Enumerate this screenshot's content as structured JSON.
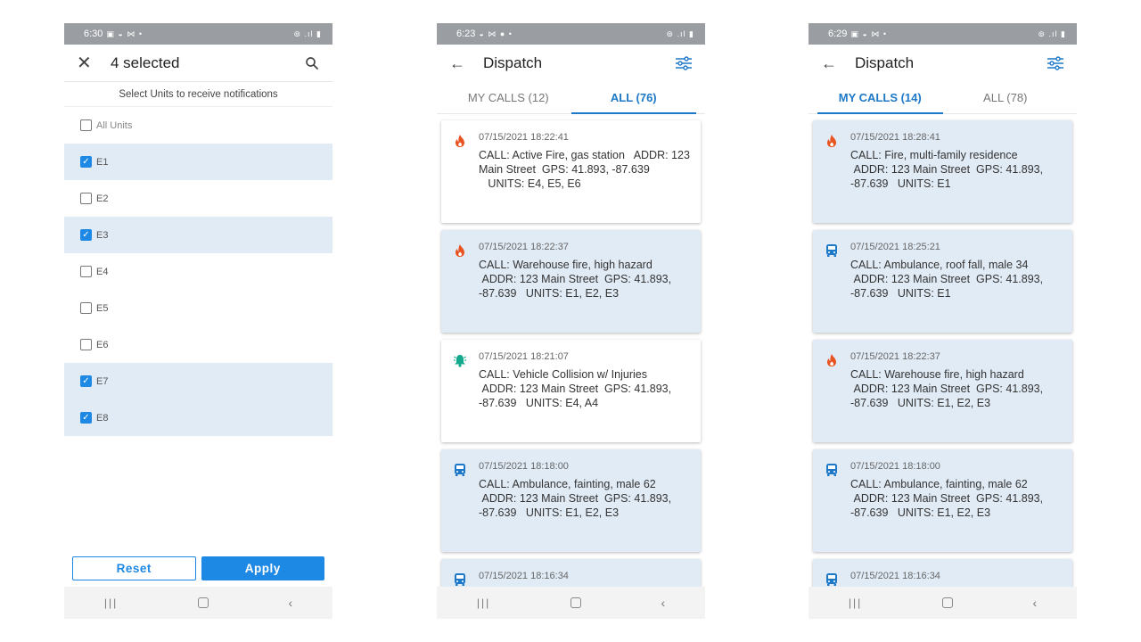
{
  "phone1": {
    "status_time": "6:30",
    "status_icons_left": "▣ ◒ ⋈ •",
    "status_icons_right": "⊚ .ıl ▮",
    "title": "4 selected",
    "subtitle": "Select Units to receive notifications",
    "all_units_label": "All Units",
    "units": [
      {
        "label": "E1",
        "checked": true
      },
      {
        "label": "E2",
        "checked": false
      },
      {
        "label": "E3",
        "checked": true
      },
      {
        "label": "E4",
        "checked": false
      },
      {
        "label": "E5",
        "checked": false
      },
      {
        "label": "E6",
        "checked": false
      },
      {
        "label": "E7",
        "checked": true
      },
      {
        "label": "E8",
        "checked": true
      }
    ],
    "reset_label": "Reset",
    "apply_label": "Apply"
  },
  "phone2": {
    "status_time": "6:23",
    "status_icons_left": "◒ ⋈ ● •",
    "status_icons_right": "⊚ .ıl ▮",
    "title": "Dispatch",
    "tab_my_calls": "MY CALLS (12)",
    "tab_all": "ALL (76)",
    "active_tab": "all",
    "cards": [
      {
        "icon": "fire-icon",
        "highlight": false,
        "time": "07/15/2021 18:22:41",
        "text": "CALL: Active Fire, gas station   ADDR: 123 Main Street  GPS: 41.893, -87.639\n   UNITS: E4, E5, E6"
      },
      {
        "icon": "fire-icon",
        "highlight": true,
        "time": "07/15/2021 18:22:37",
        "text": "CALL: Warehouse fire, high hazard\n ADDR: 123 Main Street  GPS: 41.893, -87.639   UNITS: E1, E2, E3"
      },
      {
        "icon": "alarm-bell-icon",
        "highlight": false,
        "time": "07/15/2021 18:21:07",
        "text": "CALL: Vehicle Collision w/ Injuries\n ADDR: 123 Main Street  GPS: 41.893, -87.639   UNITS: E4, A4"
      },
      {
        "icon": "ambulance-icon",
        "highlight": true,
        "time": "07/15/2021 18:18:00",
        "text": "CALL: Ambulance, fainting, male 62\n ADDR: 123 Main Street  GPS: 41.893, -87.639   UNITS: E1, E2, E3"
      },
      {
        "icon": "ambulance-icon",
        "highlight": true,
        "time": "07/15/2021 18:16:34",
        "text": ""
      }
    ]
  },
  "phone3": {
    "status_time": "6:29",
    "status_icons_left": "▣ ◒ ⋈ •",
    "status_icons_right": "⊚ .ıl ▮",
    "title": "Dispatch",
    "tab_my_calls": "MY CALLS (14)",
    "tab_all": "ALL (78)",
    "active_tab": "my",
    "cards": [
      {
        "icon": "fire-icon",
        "highlight": true,
        "time": "07/15/2021 18:28:41",
        "text": "CALL: Fire, multi-family residence\n ADDR: 123 Main Street  GPS: 41.893, -87.639   UNITS: E1"
      },
      {
        "icon": "ambulance-icon",
        "highlight": true,
        "time": "07/15/2021 18:25:21",
        "text": "CALL: Ambulance, roof fall, male 34\n ADDR: 123 Main Street  GPS: 41.893, -87.639   UNITS: E1"
      },
      {
        "icon": "fire-icon",
        "highlight": true,
        "time": "07/15/2021 18:22:37",
        "text": "CALL: Warehouse fire, high hazard\n ADDR: 123 Main Street  GPS: 41.893, -87.639   UNITS: E1, E2, E3"
      },
      {
        "icon": "ambulance-icon",
        "highlight": true,
        "time": "07/15/2021 18:18:00",
        "text": "CALL: Ambulance, fainting, male 62\n ADDR: 123 Main Street  GPS: 41.893, -87.639   UNITS: E1, E2, E3"
      },
      {
        "icon": "ambulance-icon",
        "highlight": true,
        "time": "07/15/2021 18:16:34",
        "text": ""
      }
    ]
  },
  "colors": {
    "accent": "#1e88e5",
    "highlight_bg": "#e1ebf6",
    "fire": "#e8531f",
    "ambulance": "#1e78c8",
    "alarm": "#12a98c"
  }
}
